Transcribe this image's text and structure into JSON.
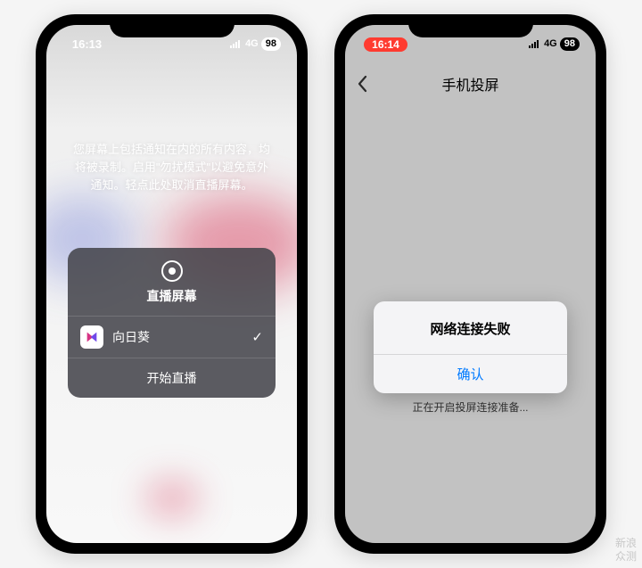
{
  "left": {
    "status": {
      "time": "16:13",
      "network": "4G",
      "battery": "98"
    },
    "instruction": "您屏幕上包括通知在内的所有内容，均将被录制。启用\"勿扰模式\"以避免意外通知。轻点此处取消直播屏幕。",
    "sheet": {
      "title": "直播屏幕",
      "app_name": "向日葵",
      "action": "开始直播"
    }
  },
  "right": {
    "status": {
      "time": "16:14",
      "network": "4G",
      "battery": "98"
    },
    "nav_title": "手机投屏",
    "alert": {
      "title": "网络连接失败",
      "confirm": "确认"
    },
    "loading": "正在开启投屏连接准备..."
  },
  "watermark": {
    "line1": "新浪",
    "line2": "众测"
  }
}
